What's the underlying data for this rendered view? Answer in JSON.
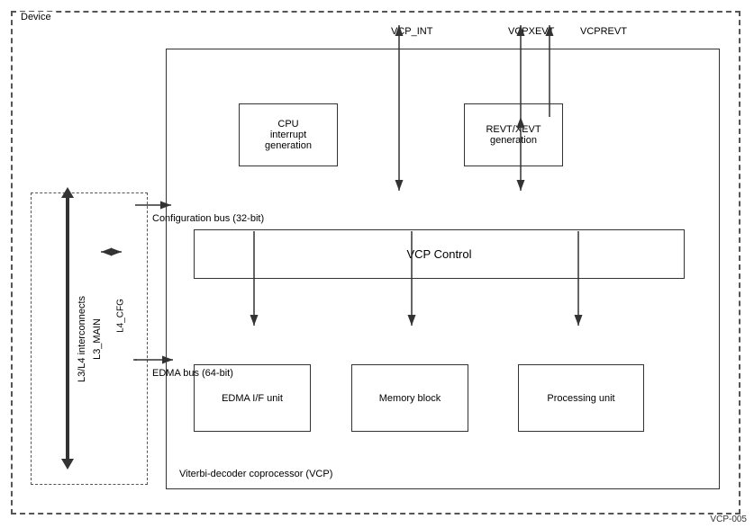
{
  "device": {
    "label": "Device"
  },
  "vcp": {
    "outer_label": "Viterbi-decoder coprocessor (VCP)"
  },
  "signals": {
    "vcp_int": "VCP_INT",
    "vcpxevt": "VCPXEVT",
    "vcprevt": "VCPREVT"
  },
  "buses": {
    "config_bus": "Configuration bus (32-bit)",
    "edma_bus": "EDMA bus (64-bit)"
  },
  "blocks": {
    "cpu_interrupt": "CPU\ninterrupt\ngeneration",
    "revt_xevt": "REVT/XEVT\ngeneration",
    "vcp_control": "VCP Control",
    "edma_if": "EDMA I/F unit",
    "memory_block": "Memory block",
    "processing_unit": "Processing unit",
    "l3l4": "L3/L4 interconnects"
  },
  "labels": {
    "l3_main": "L3_MAIN",
    "l4_cfg": "L4_CFG"
  },
  "footer": "VCP-005"
}
